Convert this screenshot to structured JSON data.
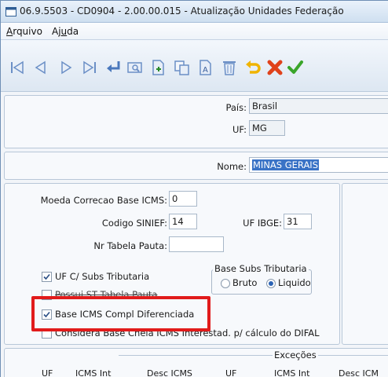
{
  "window": {
    "title": "06.9.5503 - CD0904 - 2.00.00.015 - Atualização Unidades Federação"
  },
  "menu": {
    "items": [
      {
        "key": "A",
        "rest": "rquivo"
      },
      {
        "key": "",
        "pre": "Aj",
        "ul": "u",
        "post": "da"
      }
    ]
  },
  "toolbar": {
    "buttons": [
      "first-record-icon",
      "prev-record-icon",
      "next-record-icon",
      "last-record-icon",
      "return-icon",
      "preview-icon",
      "new-icon",
      "copy-icon",
      "edit-icon",
      "delete-icon",
      "undo-icon",
      "cancel-icon",
      "confirm-icon"
    ]
  },
  "header": {
    "pais_label": "País:",
    "pais_value": "Brasil",
    "uf_label": "UF:",
    "uf_value": "MG",
    "nome_label": "Nome:",
    "nome_value": "MINAS GERAIS"
  },
  "details": {
    "moeda_label": "Moeda Correcao Base ICMS:",
    "moeda_value": "0",
    "siniefe_label": "Codigo SINIEF:",
    "siniefe_value": "14",
    "ibge_label": "UF IBGE:",
    "ibge_value": "31",
    "pauta_label": "Nr Tabela Pauta:",
    "pauta_value": "",
    "uf_subs_label": "UF C/ Subs Tributaria",
    "uf_subs_checked": true,
    "possui_st_label": "Possui ST Tabela Pauta",
    "possui_st_checked": false,
    "base_icms_label": "Base ICMS Compl Diferenciada",
    "base_icms_checked": true,
    "considera_label": "Considera Base Cheia ICMS Interestad. p/ cálculo do DIFAL",
    "considera_checked": false,
    "base_subs_title": "Base Subs Tributaria",
    "radio_bruto": "Bruto",
    "radio_liquido": "Liquido",
    "radio_selected": "Liquido"
  },
  "excecoes": {
    "title": "Exceções",
    "columns": [
      "UF",
      "ICMS Int",
      "Desc ICMS",
      "UF",
      "ICMS Int",
      "Desc ICM"
    ]
  },
  "colors": {
    "highlight": "#e11b1b",
    "selection": "#3a73c6"
  }
}
